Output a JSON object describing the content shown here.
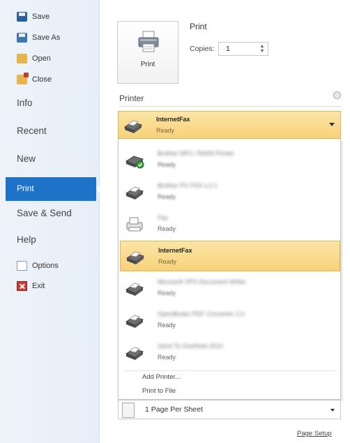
{
  "sidebar": {
    "save": "Save",
    "save_as": "Save As",
    "open": "Open",
    "close": "Close",
    "info": "Info",
    "recent": "Recent",
    "new": "New",
    "print": "Print",
    "save_send": "Save & Send",
    "help": "Help",
    "options": "Options",
    "exit": "Exit"
  },
  "print_section": {
    "button_label": "Print",
    "title": "Print",
    "copies_label": "Copies:",
    "copies_value": "1"
  },
  "printer": {
    "heading": "Printer",
    "selected_name": "InternetFax",
    "selected_status": "Ready",
    "options": [
      {
        "name": "Brother MFC-7840N Printer",
        "status": "Ready"
      },
      {
        "name": "Brother PC-FAX v.2.1",
        "status": "Ready"
      },
      {
        "name": "Fax",
        "status": "Ready"
      },
      {
        "name": "InternetFax",
        "status": "Ready"
      },
      {
        "name": "Microsoft XPS Document Writer",
        "status": "Ready"
      },
      {
        "name": "OpenBooks PDF Converter 2.0",
        "status": "Ready"
      },
      {
        "name": "Send To OneNote 2010",
        "status": "Ready"
      }
    ],
    "add_printer": "Add Printer...",
    "print_to_file": "Print to File"
  },
  "settings": {
    "pages_per_sheet": "1 Page Per Sheet"
  },
  "page_setup": "Page Setup",
  "colors": {
    "accent_blue": "#1e73c8",
    "highlight": "#f8d27a"
  }
}
